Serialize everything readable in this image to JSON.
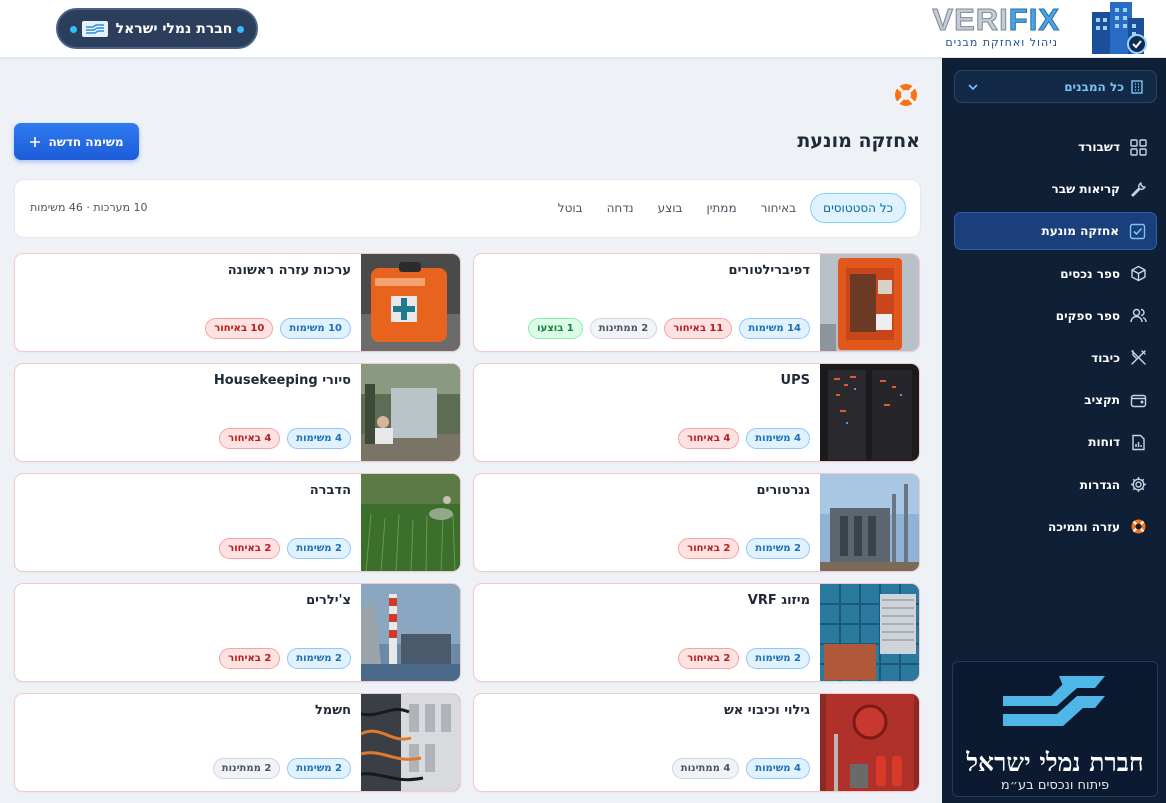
{
  "header": {
    "company_name": "חברת נמלי ישראל",
    "logo_text_a": "VERI",
    "logo_text_b": "FIX",
    "logo_subtitle": "ניהול ואחזקת מבנים"
  },
  "sidebar": {
    "building_select": "כל המבנים",
    "items": [
      {
        "label": "דשבורד",
        "icon": "grid-icon"
      },
      {
        "label": "קריאות שבר",
        "icon": "wrench-icon"
      },
      {
        "label": "אחזקה מונעת",
        "icon": "checkbox-icon",
        "active": true
      },
      {
        "label": "ספר נכסים",
        "icon": "cube-icon"
      },
      {
        "label": "ספר ספקים",
        "icon": "users-icon"
      },
      {
        "label": "כיבוד",
        "icon": "utensils-icon"
      },
      {
        "label": "תקציב",
        "icon": "wallet-icon"
      },
      {
        "label": "דוחות",
        "icon": "report-icon"
      },
      {
        "label": "הגדרות",
        "icon": "gear-icon"
      },
      {
        "label": "עזרה ותמיכה",
        "icon": "lifebuoy-icon"
      }
    ],
    "promo": {
      "name": "חברת נמלי ישראל",
      "subtitle": "פיתוח ונכסים בע״מ"
    }
  },
  "main": {
    "title": "אחזקה מונעת",
    "new_task_label": "משימה חדשה",
    "filters": [
      "כל הסטטוסים",
      "באיחור",
      "ממתין",
      "בוצע",
      "נדחה",
      "בוטל"
    ],
    "summary": "10 מערכות · 46 משימות",
    "cards": [
      {
        "title": "דפיברילטורים",
        "img": "defib",
        "badges": [
          {
            "text": "14 משימות",
            "kind": "blue"
          },
          {
            "text": "11 באיחור",
            "kind": "red"
          },
          {
            "text": "2 ממתינות",
            "kind": "gray"
          },
          {
            "text": "1 בוצעו",
            "kind": "green"
          }
        ]
      },
      {
        "title": "ערכות עזרה ראשונה",
        "img": "firstaid",
        "badges": [
          {
            "text": "10 משימות",
            "kind": "blue"
          },
          {
            "text": "10 באיחור",
            "kind": "red"
          }
        ]
      },
      {
        "title": "UPS",
        "img": "ups",
        "badges": [
          {
            "text": "4 משימות",
            "kind": "blue"
          },
          {
            "text": "4 באיחור",
            "kind": "red"
          }
        ]
      },
      {
        "title": "סיורי Housekeeping",
        "img": "house",
        "badges": [
          {
            "text": "4 משימות",
            "kind": "blue"
          },
          {
            "text": "4 באיחור",
            "kind": "red"
          }
        ]
      },
      {
        "title": "גנרטורים",
        "img": "gen",
        "badges": [
          {
            "text": "2 משימות",
            "kind": "blue"
          },
          {
            "text": "2 באיחור",
            "kind": "red"
          }
        ]
      },
      {
        "title": "הדברה",
        "img": "pest",
        "badges": [
          {
            "text": "2 משימות",
            "kind": "blue"
          },
          {
            "text": "2 באיחור",
            "kind": "red"
          }
        ]
      },
      {
        "title": "מיזוג VRF",
        "img": "vrf",
        "badges": [
          {
            "text": "2 משימות",
            "kind": "blue"
          },
          {
            "text": "2 באיחור",
            "kind": "red"
          }
        ]
      },
      {
        "title": "צ'ילרים",
        "img": "chiller",
        "badges": [
          {
            "text": "2 משימות",
            "kind": "blue"
          },
          {
            "text": "2 באיחור",
            "kind": "red"
          }
        ]
      },
      {
        "title": "גילוי וכיבוי אש",
        "img": "fire",
        "badges": [
          {
            "text": "4 משימות",
            "kind": "blue"
          },
          {
            "text": "4 ממתינות",
            "kind": "gray"
          }
        ]
      },
      {
        "title": "חשמל",
        "img": "elec",
        "badges": [
          {
            "text": "2 משימות",
            "kind": "blue"
          },
          {
            "text": "2 ממתינות",
            "kind": "gray"
          }
        ]
      }
    ]
  }
}
